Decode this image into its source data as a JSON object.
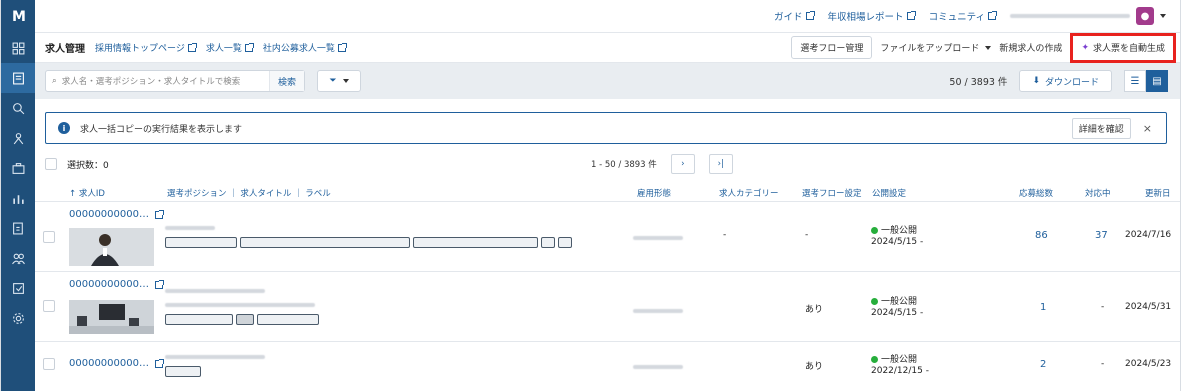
{
  "logo": "M",
  "header": {
    "links": [
      "ガイド",
      "年収相場レポート",
      "コミュニティ"
    ]
  },
  "subheader": {
    "title": "求人管理",
    "links": [
      "採用情報トップページ",
      "求人一覧",
      "社内公募求人一覧"
    ],
    "flow_btn": "選考フロー管理",
    "upload_btn": "ファイルをアップロード",
    "create_btn": "新規求人の作成",
    "auto_btn": "求人票を自動生成"
  },
  "toolbar": {
    "search_placeholder": "求人名・選考ポジション・求人タイトルで検索",
    "search_btn": "検索",
    "count": "50 / 3893 件",
    "download": "ダウンロード"
  },
  "notice": {
    "text": "求人一括コピーの実行結果を表示します",
    "detail_btn": "詳細を確認",
    "info_icon": "i",
    "close_icon": "×"
  },
  "selection": {
    "label": "選択数：0",
    "range": "1 - 50 / 3893 件"
  },
  "columns": [
    "↑ 求人ID",
    "選考ポジション ｜ 求人タイトル ｜ ラベル",
    "雇用形態",
    "求人カテゴリー",
    "選考フロー設定",
    "公開設定",
    "応募総数",
    "対応中",
    "更新日"
  ],
  "rows": [
    {
      "id": "00000000000…",
      "category": "-",
      "flow": "-",
      "status": "一般公開",
      "date_open": "2024/5/15 -",
      "applicants": "86",
      "active": "37",
      "updated": "2024/7/16"
    },
    {
      "id": "00000000000…",
      "category": "",
      "flow": "あり",
      "status": "一般公開",
      "date_open": "2024/5/15 -",
      "applicants": "1",
      "active": "-",
      "updated": "2024/5/31"
    },
    {
      "id": "00000000000…",
      "category": "",
      "flow": "あり",
      "status": "一般公開",
      "date_open": "2022/12/15 -",
      "applicants": "2",
      "active": "-",
      "updated": "2024/5/23"
    }
  ],
  "colors": {
    "brand": "#1f4f7a",
    "accent": "#1f5f9c",
    "highlight": "#e8221e",
    "status_green": "#27ae3c"
  }
}
